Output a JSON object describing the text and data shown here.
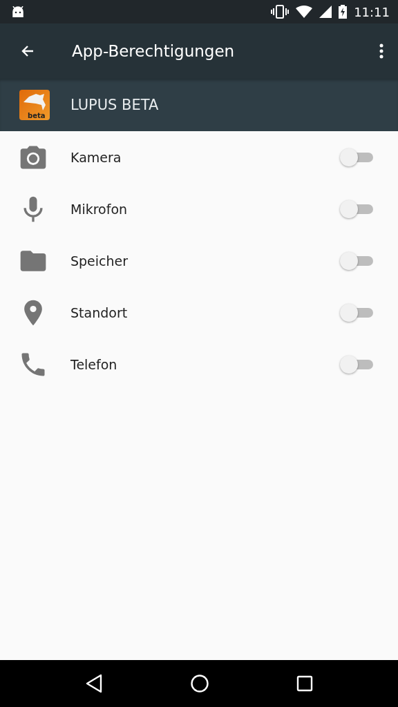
{
  "status_bar": {
    "time": "11:11"
  },
  "toolbar": {
    "title": "App-Berechtigungen"
  },
  "app": {
    "name": "LUPUS BETA",
    "icon_label": "beta"
  },
  "permissions": [
    {
      "label": "Kamera",
      "on": false
    },
    {
      "label": "Mikrofon",
      "on": false
    },
    {
      "label": "Speicher",
      "on": false
    },
    {
      "label": "Standort",
      "on": false
    },
    {
      "label": "Telefon",
      "on": false
    }
  ]
}
